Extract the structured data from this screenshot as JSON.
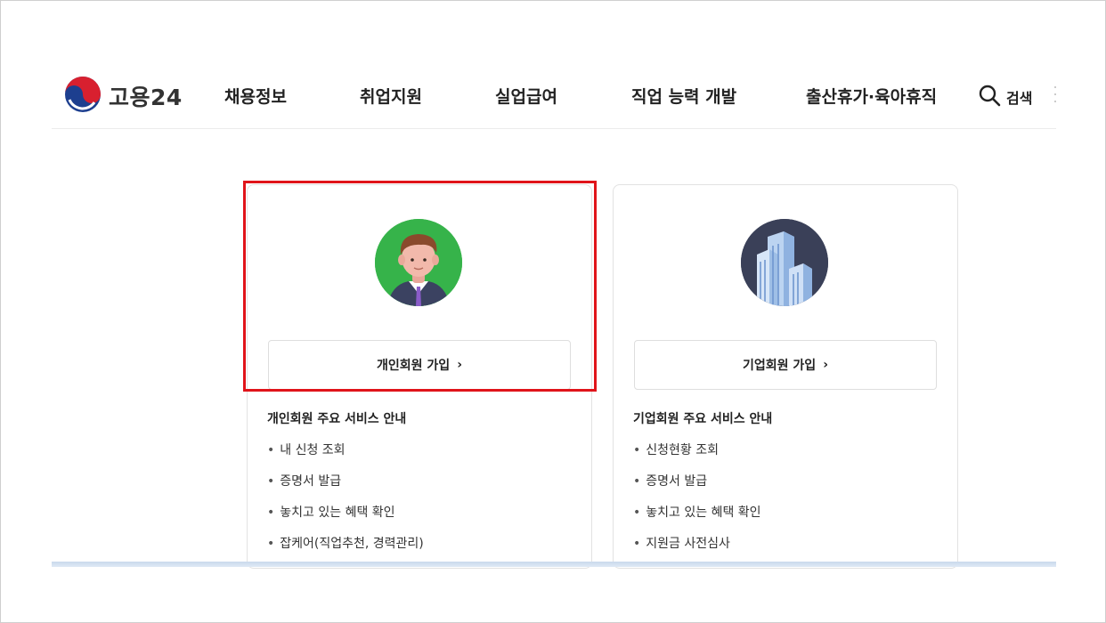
{
  "header": {
    "logo_text": "고용24",
    "nav": [
      {
        "label": "채용정보"
      },
      {
        "label": "취업지원"
      },
      {
        "label": "실업급여"
      },
      {
        "label": "직업 능력 개발"
      },
      {
        "label": "출산휴가·육아휴직"
      }
    ],
    "search_label": "검색",
    "icons": {
      "search": "search-icon",
      "more": "more-dots-icon",
      "logo": "taegeuk-logo-icon"
    }
  },
  "cards": {
    "personal": {
      "icon": "person-avatar-icon",
      "button_label": "개인회원 가입",
      "button_chevron": "›",
      "services_title": "개인회원 주요 서비스 안내",
      "services": [
        "내 신청 조회",
        "증명서 발급",
        "놓치고 있는 혜택 확인",
        "잡케어(직업추천, 경력관리)"
      ]
    },
    "company": {
      "icon": "building-icon",
      "button_label": "기업회원 가입",
      "button_chevron": "›",
      "services_title": "기업회원 주요 서비스 안내",
      "services": [
        "신청현황 조회",
        "증명서 발급",
        "놓치고 있는 혜택 확인",
        "지원금 사전심사"
      ]
    }
  },
  "colors": {
    "highlight": "#e0141a",
    "person_bg": "#36b34a",
    "building_bg": "#3a4058"
  }
}
